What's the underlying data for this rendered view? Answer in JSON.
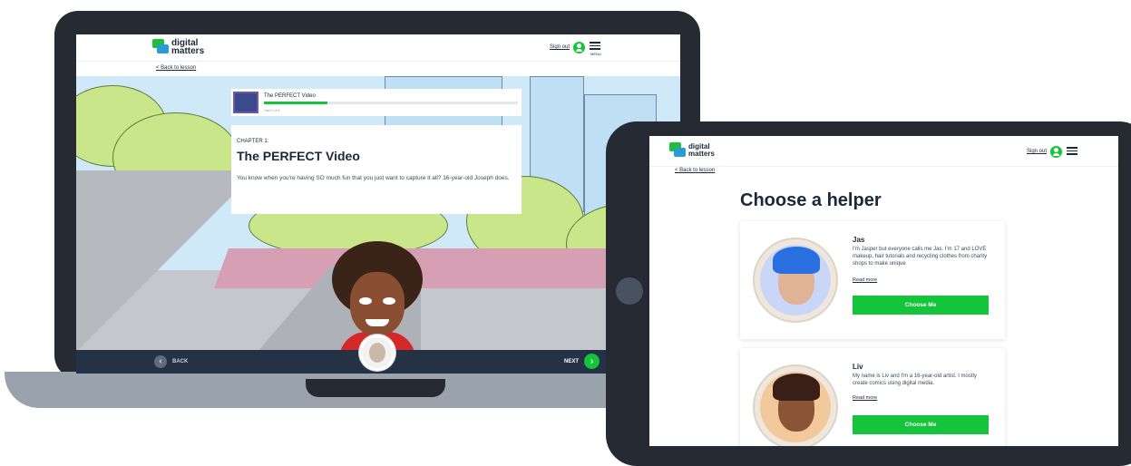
{
  "laptop": {
    "brand_line1": "digital",
    "brand_line2": "matters",
    "sign_out": "Sign out",
    "menu_label": "MENU",
    "back_to_lesson": "< Back to lesson",
    "chapter_title": "The PERFECT Video",
    "card_progress_text": "Card 1 of 6",
    "chapter_progress": 0.25,
    "chapter_label": "CHAPTER 1:",
    "chapter_heading": "The PERFECT Video",
    "chapter_body": "You know when you're having SO much fun that you just want to capture it all? 16-year-old Joseph does.",
    "back_label": "BACK",
    "next_label": "NEXT"
  },
  "tablet": {
    "brand_line1": "digital",
    "brand_line2": "matters",
    "sign_out": "Sign out",
    "back_to_lesson": "< Back to lesson",
    "page_title": "Choose a helper",
    "helpers": [
      {
        "name": "Jas",
        "description": "I'm Jasper but everyone calls me Jas. I'm 17 and LOVE makeup, hair tutorials and recycling clothes from charity shops to make unique",
        "read_more": "Read more",
        "button": "Choose Me",
        "hair_color": "#2a6fe0",
        "bg_color": "#c9d6f7",
        "skin_color": "#e0b296"
      },
      {
        "name": "Liv",
        "description": "My name is Liv and I'm a 16-year-old artist. I mostly create comics using digital media.",
        "read_more": "Read more",
        "button": "Choose Me",
        "hair_color": "#3a1f18",
        "bg_color": "#f2c99a",
        "skin_color": "#8a5436"
      }
    ]
  },
  "colors": {
    "accent_green": "#14c43a",
    "navy": "#1b2a3a",
    "footer": "#243245",
    "device_frame": "#262b33"
  }
}
